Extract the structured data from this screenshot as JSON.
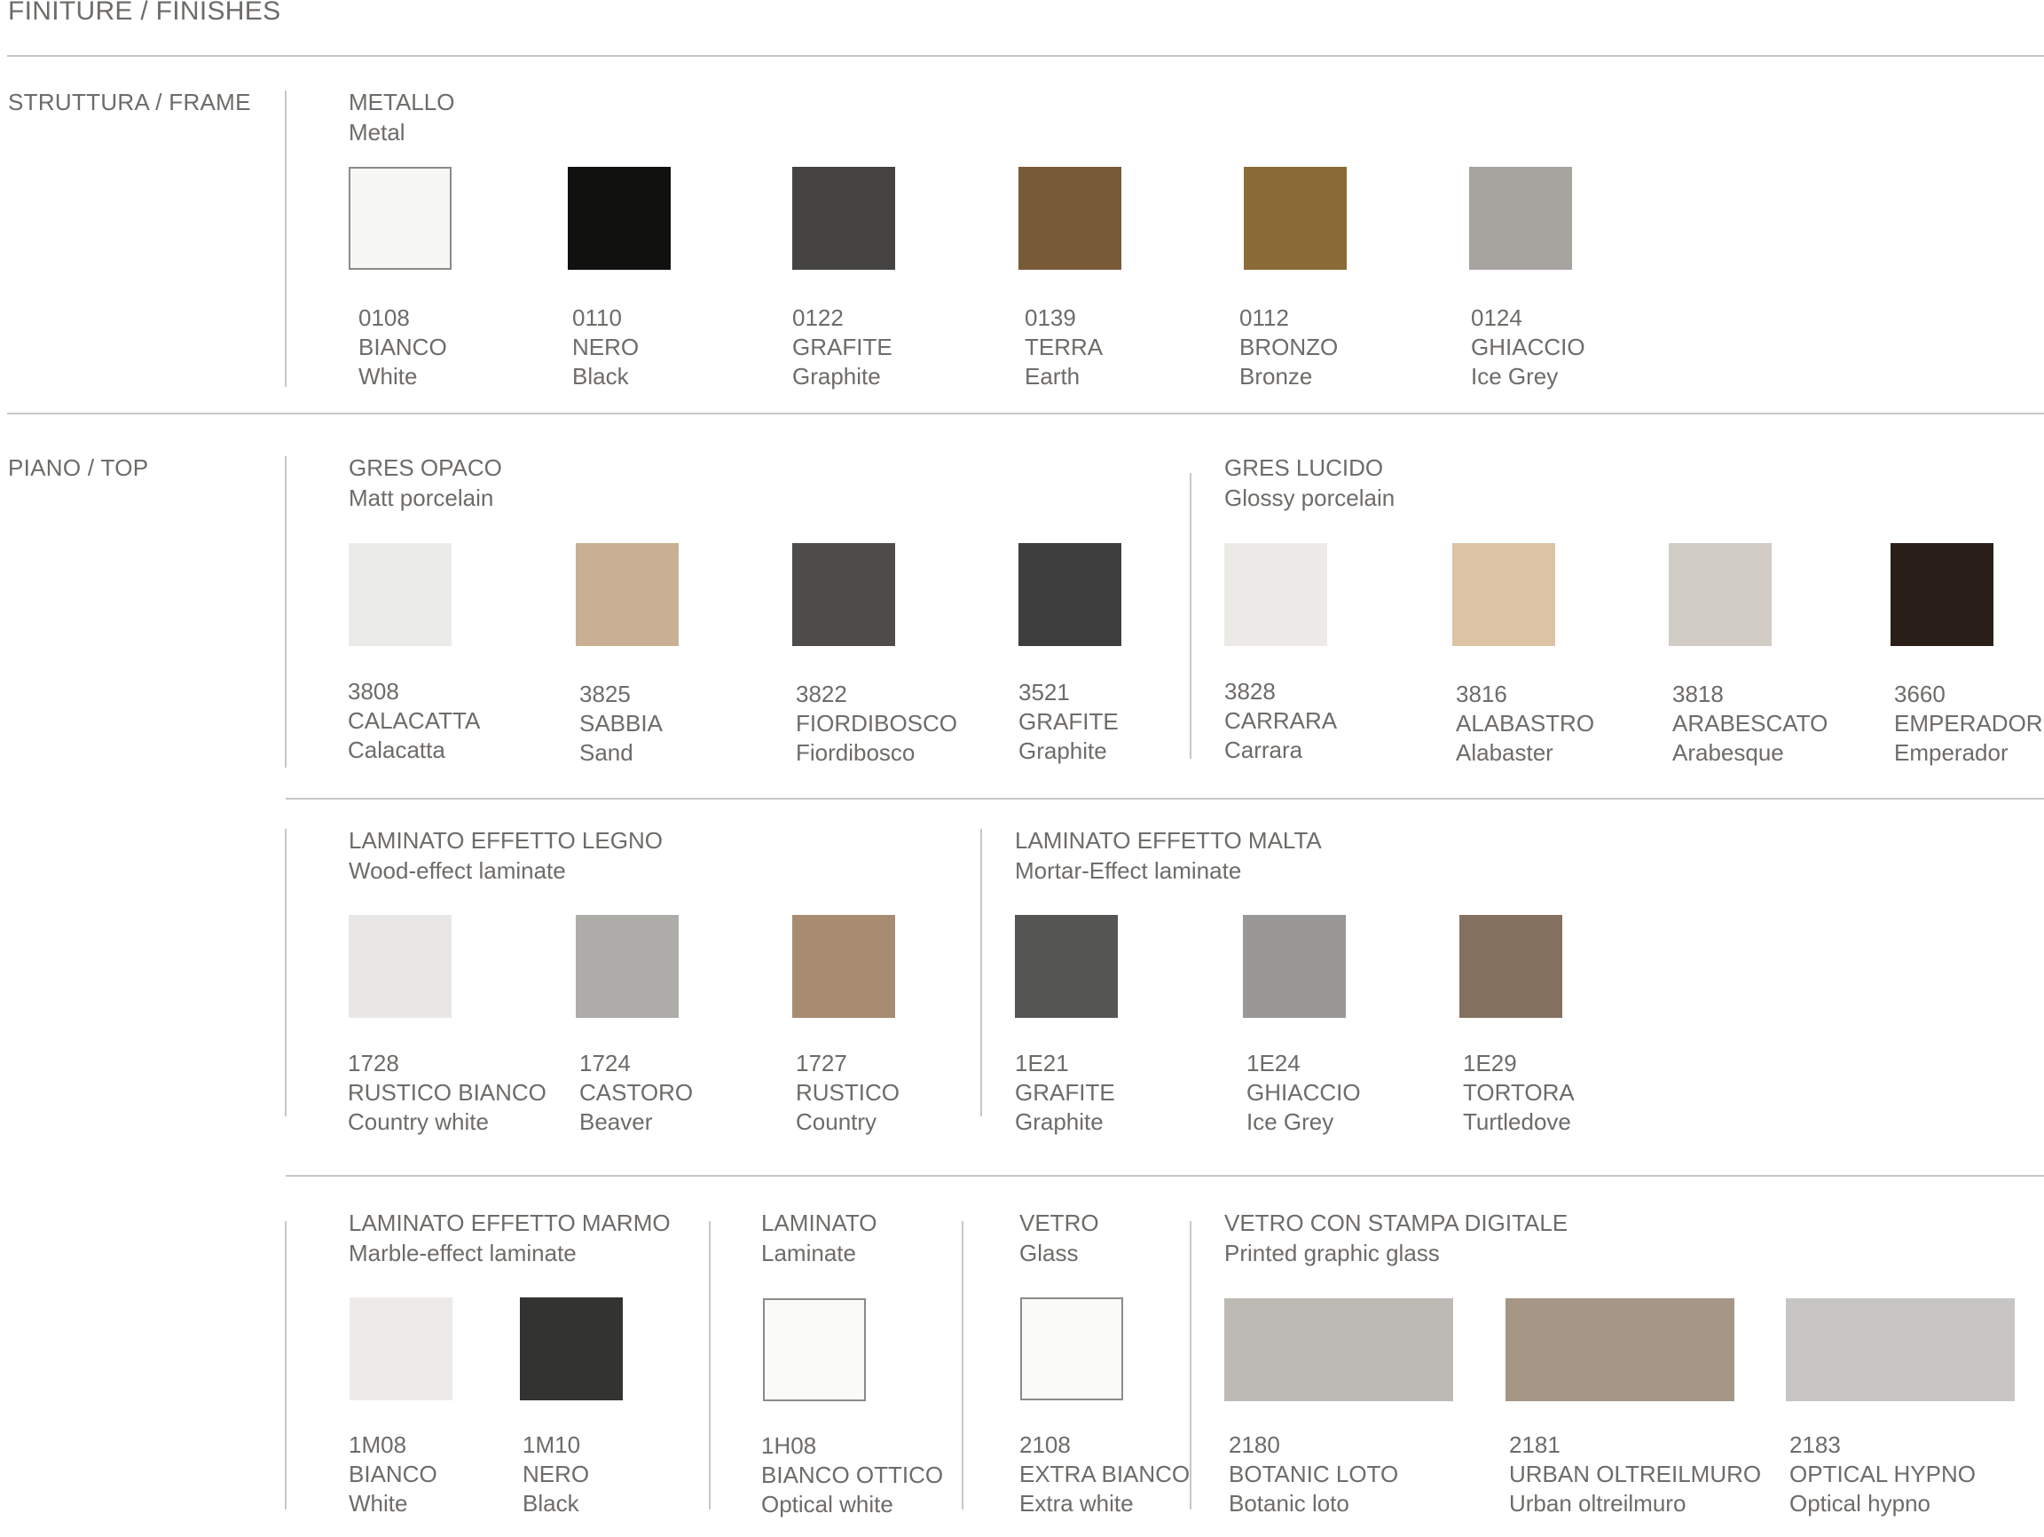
{
  "page_title": "FINITURE / FINISHES",
  "sections": {
    "frame": {
      "label": "STRUTTURA / FRAME",
      "groups": [
        {
          "name": "METALLO",
          "subname": "Metal",
          "swatches": [
            {
              "code": "0108",
              "name": "BIANCO",
              "en": "White",
              "color": "#f7f7f5"
            },
            {
              "code": "0110",
              "name": "NERO",
              "en": "Black",
              "color": "#111110"
            },
            {
              "code": "0122",
              "name": "GRAFITE",
              "en": "Graphite",
              "color": "#444341"
            },
            {
              "code": "0139",
              "name": "TERRA",
              "en": "Earth",
              "color": "#785a36"
            },
            {
              "code": "0112",
              "name": "BRONZO",
              "en": "Bronze",
              "color": "#8a6b36"
            },
            {
              "code": "0124",
              "name": "GHIACCIO",
              "en": "Ice Grey",
              "color": "#a7a39f"
            }
          ]
        }
      ]
    },
    "top": {
      "label": "PIANO / TOP",
      "groups": [
        {
          "name": "GRES OPACO",
          "subname": "Matt porcelain",
          "swatches": [
            {
              "code": "3808",
              "name": "CALACATTA",
              "en": "Calacatta",
              "color": "#ebebe8"
            },
            {
              "code": "3825",
              "name": "SABBIA",
              "en": "Sand",
              "color": "#c9b095"
            },
            {
              "code": "3822",
              "name": "FIORDIBOSCO",
              "en": "Fiordibosco",
              "color": "#4d4c4a"
            },
            {
              "code": "3521",
              "name": "GRAFITE",
              "en": "Graphite",
              "color": "#3e3e3e"
            }
          ]
        },
        {
          "name": "GRES LUCIDO",
          "subname": "Glossy porcelain",
          "swatches": [
            {
              "code": "3828",
              "name": "CARRARA",
              "en": "Carrara",
              "color": "#eceae6"
            },
            {
              "code": "3816",
              "name": "ALABASTRO",
              "en": "Alabaster",
              "color": "#dcc3a6"
            },
            {
              "code": "3818",
              "name": "ARABESCATO",
              "en": "Arabesque",
              "color": "#d1ccc5"
            },
            {
              "code": "3660",
              "name": "EMPERADOR",
              "en": "Emperador",
              "color": "#2a1f18"
            }
          ]
        },
        {
          "name": "LAMINATO EFFETTO LEGNO",
          "subname": "Wood-effect laminate",
          "swatches": [
            {
              "code": "1728",
              "name": "RUSTICO BIANCO",
              "en": "Country white",
              "color": "#e8e7e5"
            },
            {
              "code": "1724",
              "name": "CASTORO",
              "en": "Beaver",
              "color": "#adaca8"
            },
            {
              "code": "1727",
              "name": "RUSTICO",
              "en": "Country",
              "color": "#a88c72"
            }
          ]
        },
        {
          "name": "LAMINATO EFFETTO MALTA",
          "subname": "Mortar-Effect laminate",
          "swatches": [
            {
              "code": "1E21",
              "name": "GRAFITE",
              "en": "Graphite",
              "color": "#555554"
            },
            {
              "code": "1E24",
              "name": "GHIACCIO",
              "en": "Ice Grey",
              "color": "#999896"
            },
            {
              "code": "1E29",
              "name": "TORTORA",
              "en": "Turtledove",
              "color": "#85715f"
            }
          ]
        },
        {
          "name": "LAMINATO EFFETTO MARMO",
          "subname": "Marble-effect laminate",
          "swatches": [
            {
              "code": "1M08",
              "name": "BIANCO",
              "en": "White",
              "color": "#ecebe9"
            },
            {
              "code": "1M10",
              "name": "NERO",
              "en": "Black",
              "color": "#333332"
            }
          ]
        },
        {
          "name": "LAMINATO",
          "subname": "Laminate",
          "swatches": [
            {
              "code": "1H08",
              "name": "BIANCO OTTICO",
              "en": "Optical white",
              "color": "#fafaf9"
            }
          ]
        },
        {
          "name": "VETRO",
          "subname": "Glass",
          "swatches": [
            {
              "code": "2108",
              "name": "EXTRA BIANCO",
              "en": "Extra white",
              "color": "#fafaf9"
            }
          ]
        },
        {
          "name": "VETRO CON STAMPA DIGITALE",
          "subname": "Printed graphic glass",
          "swatches": [
            {
              "code": "2180",
              "name": "BOTANIC LOTO",
              "en": "Botanic loto",
              "color": "#bdbab5"
            },
            {
              "code": "2181",
              "name": "URBAN OLTREILMURO",
              "en": "Urban oltreilmuro",
              "color": "#a59686"
            },
            {
              "code": "2183",
              "name": "OPTICAL HYPNO",
              "en": "Optical hypno",
              "color": "#c7c6c4"
            }
          ]
        }
      ]
    }
  }
}
